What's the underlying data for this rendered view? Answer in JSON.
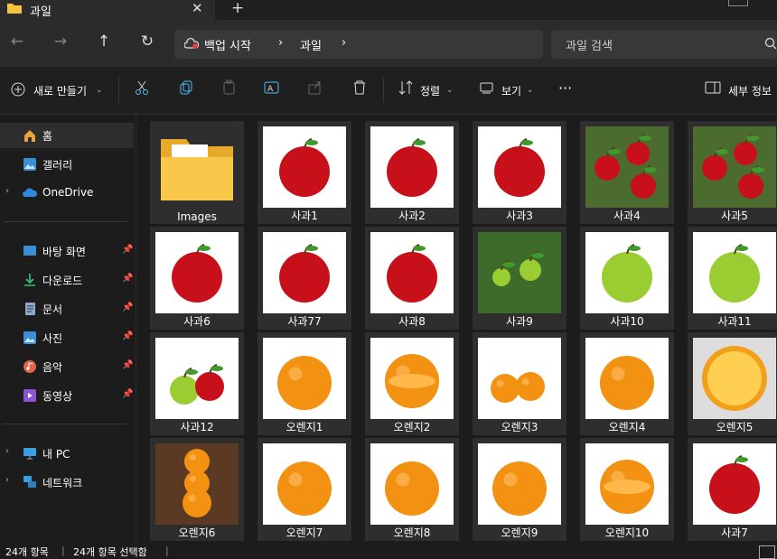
{
  "window": {
    "tab_title": "과일",
    "tab_close": "✕",
    "tab_add": "+"
  },
  "nav": {
    "breadcrumb_root": "백업 시작",
    "breadcrumb_sep": "›",
    "breadcrumb_current": "과일",
    "search_placeholder": "과일 검색"
  },
  "toolbar": {
    "new_label": "새로 만들기",
    "sort_label": "정렬",
    "view_label": "보기",
    "more_label": "···",
    "details_label": "세부 정보"
  },
  "sidebar": {
    "items": [
      {
        "label": "홈",
        "icon": "home-icon"
      },
      {
        "label": "갤러리",
        "icon": "gallery-icon"
      },
      {
        "label": "OneDrive",
        "icon": "cloud-icon"
      },
      {
        "label": "바탕 화면",
        "icon": "desktop-icon"
      },
      {
        "label": "다운로드",
        "icon": "download-icon"
      },
      {
        "label": "문서",
        "icon": "document-icon"
      },
      {
        "label": "사진",
        "icon": "pictures-icon"
      },
      {
        "label": "음악",
        "icon": "music-icon"
      },
      {
        "label": "동영상",
        "icon": "video-icon"
      },
      {
        "label": "내 PC",
        "icon": "pc-icon"
      },
      {
        "label": "네트워크",
        "icon": "network-icon"
      }
    ]
  },
  "files": [
    {
      "name": "Images",
      "kind": "folder"
    },
    {
      "name": "사과1",
      "kind": "apple"
    },
    {
      "name": "사과2",
      "kind": "apple"
    },
    {
      "name": "사과3",
      "kind": "apple"
    },
    {
      "name": "사과4",
      "kind": "apple-tree"
    },
    {
      "name": "사과5",
      "kind": "apple-tree"
    },
    {
      "name": "사과6",
      "kind": "apple"
    },
    {
      "name": "사과77",
      "kind": "apple"
    },
    {
      "name": "사과8",
      "kind": "apple"
    },
    {
      "name": "사과9",
      "kind": "green-tree"
    },
    {
      "name": "사과10",
      "kind": "green-apple"
    },
    {
      "name": "사과11",
      "kind": "green-apple"
    },
    {
      "name": "사과12",
      "kind": "apple-pair"
    },
    {
      "name": "오렌지1",
      "kind": "orange"
    },
    {
      "name": "오렌지2",
      "kind": "orange-cut"
    },
    {
      "name": "오렌지3",
      "kind": "orange-pair"
    },
    {
      "name": "오렌지4",
      "kind": "orange"
    },
    {
      "name": "오렌지5",
      "kind": "orange-slice"
    },
    {
      "name": "오렌지6",
      "kind": "orange-stack"
    },
    {
      "name": "오렌지7",
      "kind": "orange"
    },
    {
      "name": "오렌지8",
      "kind": "orange"
    },
    {
      "name": "오렌지9",
      "kind": "orange"
    },
    {
      "name": "오렌지10",
      "kind": "orange-cut"
    },
    {
      "name": "사과7",
      "kind": "apple"
    }
  ],
  "status": {
    "count": "24개 항목",
    "selected": "24개 항목 선택함"
  },
  "colors": {
    "accent": "#4cc2ff",
    "folder": "#f5c342",
    "apple_red": "#c8101a",
    "apple_green": "#9acd32",
    "orange": "#f39112"
  }
}
